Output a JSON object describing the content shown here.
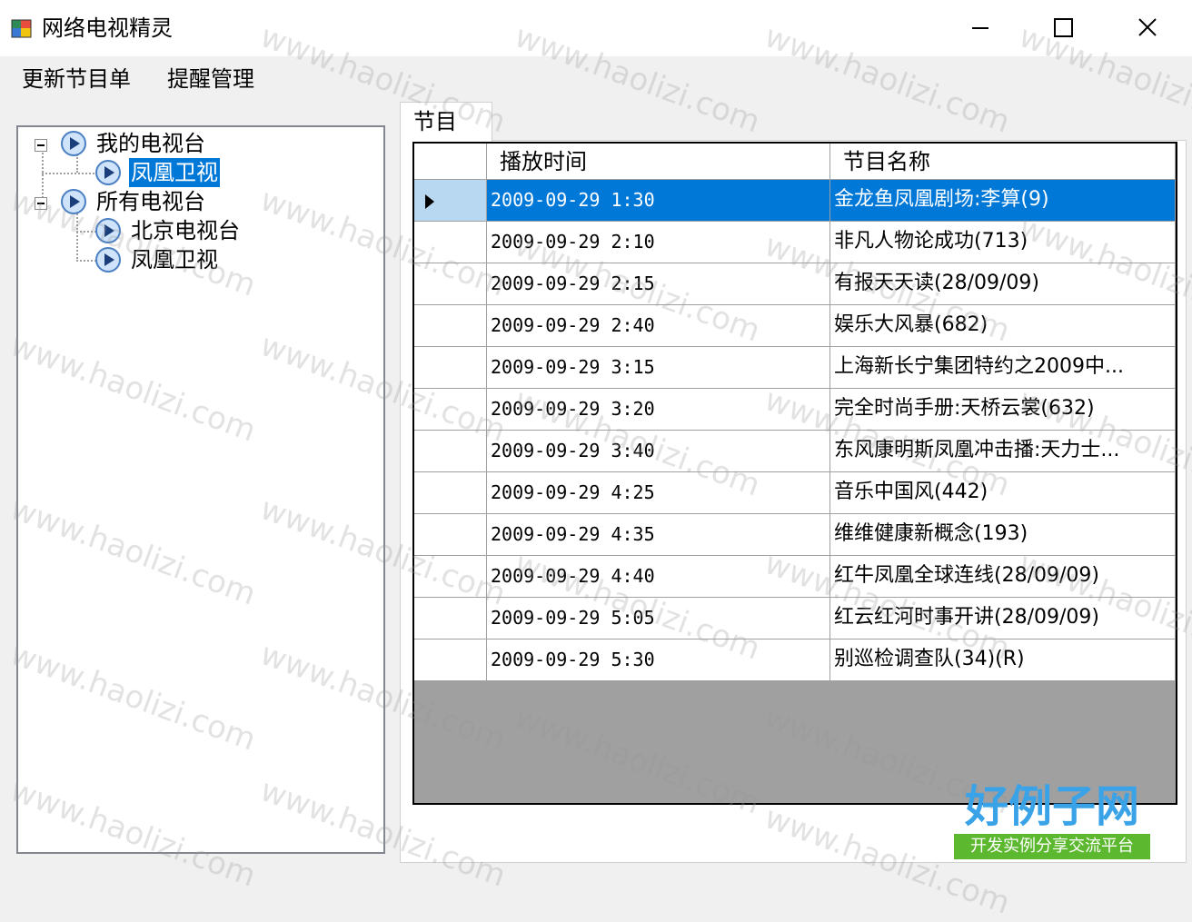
{
  "window": {
    "title": "网络电视精灵"
  },
  "menu": {
    "items": [
      "更新节目单",
      "提醒管理"
    ]
  },
  "tree": {
    "nodes": [
      {
        "label": "我的电视台",
        "expanded": true
      },
      {
        "label": "凤凰卫视",
        "selected": true
      },
      {
        "label": "所有电视台",
        "expanded": true
      },
      {
        "label": "北京电视台"
      },
      {
        "label": "凤凰卫视"
      }
    ]
  },
  "tab": {
    "label": "节目"
  },
  "grid": {
    "columns": [
      "播放时间",
      "节目名称"
    ],
    "rows": [
      {
        "time": "2009-09-29 1:30",
        "name": "金龙鱼凤凰剧场:李算(9)"
      },
      {
        "time": "2009-09-29 2:10",
        "name": "非凡人物论成功(713)"
      },
      {
        "time": "2009-09-29 2:15",
        "name": "有报天天读(28/09/09)"
      },
      {
        "time": "2009-09-29 2:40",
        "name": "娱乐大风暴(682)"
      },
      {
        "time": "2009-09-29 3:15",
        "name": "上海新长宁集团特约之2009中..."
      },
      {
        "time": "2009-09-29 3:20",
        "name": "完全时尚手册:天桥云裳(632)"
      },
      {
        "time": "2009-09-29 3:40",
        "name": "东风康明斯凤凰冲击播:天力士..."
      },
      {
        "time": "2009-09-29 4:25",
        "name": "音乐中国风(442)"
      },
      {
        "time": "2009-09-29 4:35",
        "name": "维维健康新概念(193)"
      },
      {
        "time": "2009-09-29 4:40",
        "name": "红牛凤凰全球连线(28/09/09)"
      },
      {
        "time": "2009-09-29 5:05",
        "name": "红云红河时事开讲(28/09/09)"
      },
      {
        "time": "2009-09-29 5:30",
        "name": "别巡检调查队(34)(R)"
      }
    ],
    "selected_row": 0
  },
  "watermark": {
    "text": "www.haolizi.com"
  },
  "logo": {
    "main": "好例子网",
    "sub": "开发实例分享交流平台"
  }
}
